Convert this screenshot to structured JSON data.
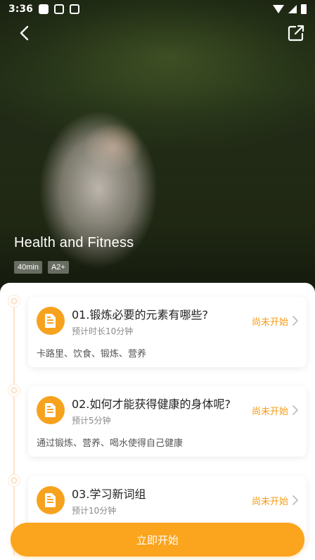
{
  "status_bar": {
    "time": "3:36"
  },
  "hero": {
    "title": "Health and Fitness",
    "tags": [
      "40min",
      "A2+"
    ]
  },
  "lessons": [
    {
      "title": "01.锻炼必要的元素有哪些?",
      "duration": "预计时长10分钟",
      "desc": "卡路里、饮食、锻炼、营养",
      "status": "尚未开始"
    },
    {
      "title": "02.如何才能获得健康的身体呢?",
      "duration": "预计5分钟",
      "desc": "通过锻炼、营养、喝水使得自己健康",
      "status": "尚未开始"
    },
    {
      "title": "03.学习新词组",
      "duration": "预计10分钟",
      "desc": "",
      "status": "尚未开始"
    }
  ],
  "start_button": {
    "label": "立即开始"
  },
  "colors": {
    "accent": "#fba41d",
    "status_text": "#f59b12",
    "timeline": "#fde8d3"
  },
  "icons": {
    "back": "chevron-left-icon",
    "share": "share-icon",
    "lesson": "document-icon",
    "chevron": "chevron-right-icon"
  }
}
